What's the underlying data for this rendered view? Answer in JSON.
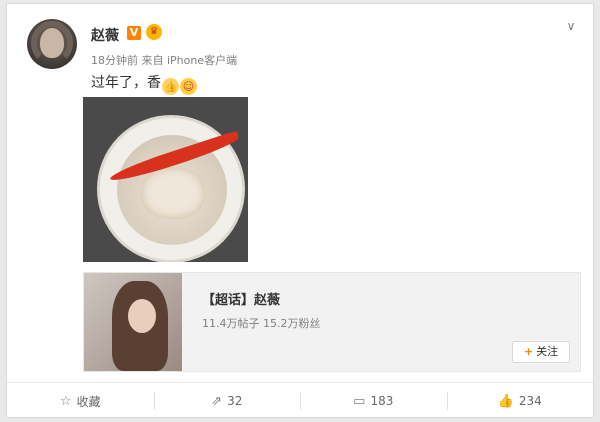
{
  "post": {
    "username": "赵薇",
    "verified_badge": "V",
    "time_source": "18分钟前 来自 iPhone客户端",
    "text": "过年了，香",
    "emojis": [
      "thumbs-up-emoji",
      "blushing-face-emoji"
    ]
  },
  "super_topic": {
    "title": "【超话】赵薇",
    "stats": "11.4万帖子 15.2万粉丝",
    "follow_label": "关注"
  },
  "actions": {
    "favorite": "收藏",
    "repost": "32",
    "comment": "183",
    "like": "234"
  },
  "icons": {
    "more": "chevron-down-icon",
    "favorite": "star-icon",
    "repost": "share-icon",
    "comment": "comment-icon",
    "like": "thumbs-up-icon"
  },
  "colors": {
    "accent": "#ff8200",
    "text": "#333333",
    "muted": "#808080"
  }
}
